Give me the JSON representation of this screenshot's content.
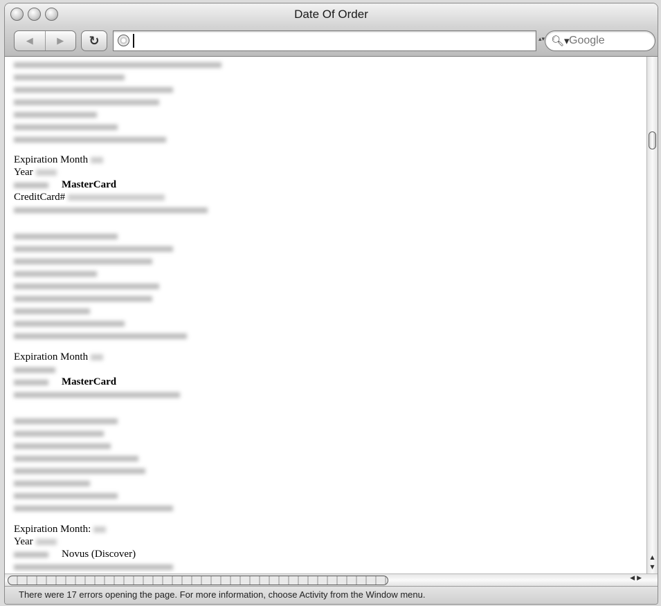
{
  "window": {
    "title": "Date Of Order"
  },
  "toolbar": {
    "back_icon": "back-arrow-icon",
    "forward_icon": "forward-arrow-icon",
    "reload_icon": "reload-icon",
    "address_value": "",
    "search_placeholder": "Google"
  },
  "page": {
    "labels": {
      "expiration_month_1": "Expiration Month",
      "year_1": "Year",
      "card_type_1": "MasterCard",
      "credit_card_label": "CreditCard#",
      "expiration_month_2": "Expiration Month",
      "card_type_2": "MasterCard",
      "expiration_month_3": "Expiration Month:",
      "year_3": "Year",
      "card_type_3": "Novus (Discover)"
    }
  },
  "status": {
    "text": "There were 17 errors opening the page. For more information, choose Activity from the Window menu."
  }
}
